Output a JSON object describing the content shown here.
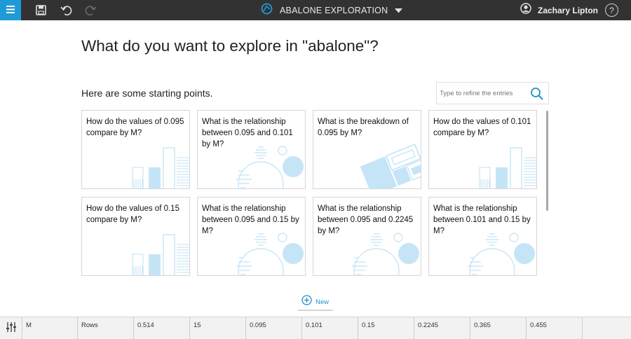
{
  "topbar": {
    "app_title": "ABALONE EXPLORATION",
    "user_name": "Zachary Lipton",
    "help_label": "?",
    "icons": [
      "menu-icon",
      "save-icon",
      "undo-icon",
      "redo-icon",
      "exploration-icon",
      "chevron-down-icon",
      "user-icon",
      "help-icon"
    ],
    "accent_color": "#1e9ad6"
  },
  "main": {
    "title": "What do you want to explore in \"abalone\"?",
    "subtitle": "Here are some starting points.",
    "search_placeholder": "Type to refine the entries",
    "cards": [
      {
        "text": "How do the values of 0.095 compare by M?",
        "kind": "bar"
      },
      {
        "text": "What is the relationship between 0.095 and 0.101 by M?",
        "kind": "scatter"
      },
      {
        "text": "What is the breakdown of 0.095 by M?",
        "kind": "treemap"
      },
      {
        "text": "How do the values of 0.101 compare by M?",
        "kind": "bar"
      },
      {
        "text": "How do the values of 0.15 compare by M?",
        "kind": "bar"
      },
      {
        "text": "What is the relationship between 0.095 and 0.15 by M?",
        "kind": "scatter"
      },
      {
        "text": "What is the relationship between 0.095 and 0.2245 by M?",
        "kind": "scatter"
      },
      {
        "text": "What is the relationship between 0.101 and 0.15 by M?",
        "kind": "scatter"
      }
    ],
    "new_label": "New"
  },
  "bottombar": {
    "columns": [
      "M",
      "Rows",
      "0.514",
      "15",
      "0.095",
      "0.101",
      "0.15",
      "0.2245",
      "0.365",
      "0.455"
    ]
  },
  "colors": {
    "thumb_fill": "#c5e5f7",
    "thumb_stroke": "#bfe1f5",
    "link_blue": "#1e8fd0"
  }
}
